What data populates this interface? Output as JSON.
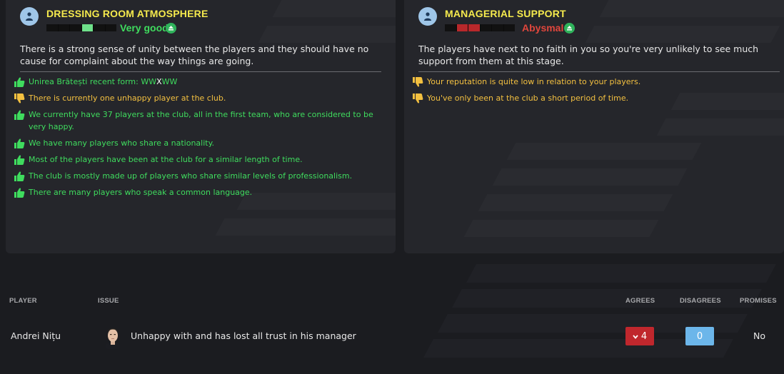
{
  "dressing_room": {
    "title": "DRESSING ROOM ATMOSPHERE",
    "rating": "Very good",
    "rating_color": "#3fdc5e",
    "level": 0.6,
    "summary": "There is a strong sense of unity between the players and they should have no cause for complaint about the way things are going.",
    "reasons": [
      {
        "type": "positive",
        "text": "Unirea Brătești recent form: WWXWW",
        "form": [
          "W",
          "W",
          "X",
          "W",
          "W"
        ]
      },
      {
        "type": "negative",
        "text": "There is currently one unhappy player at the club."
      },
      {
        "type": "positive",
        "text": "We currently have 37 players at the club, all in the first team, who are considered to be very happy."
      },
      {
        "type": "positive",
        "text": "We have many players who share a nationality."
      },
      {
        "type": "positive",
        "text": "Most of the players have been at the club for a similar length of time."
      },
      {
        "type": "positive",
        "text": "The club is mostly made up of players who share similar levels of professionalism."
      },
      {
        "type": "positive",
        "text": "There are many players who speak a common language."
      }
    ]
  },
  "managerial_support": {
    "title": "MANAGERIAL SUPPORT",
    "rating": "Abysmal",
    "rating_color": "#e0463c",
    "level": 0.1,
    "summary": "The players have next to no faith in you so you're very unlikely to see much support from them at this stage.",
    "reasons": [
      {
        "type": "negative",
        "text": "Your reputation is quite low in relation to your players."
      },
      {
        "type": "negative",
        "text": "You've only been at the club a short period of time."
      }
    ]
  },
  "table": {
    "headers": {
      "player": "PLAYER",
      "issue": "ISSUE",
      "agrees": "AGREES",
      "disagrees": "DISAGREES",
      "promises": "PROMISES"
    },
    "rows": [
      {
        "player": "Andrei Nițu",
        "issue": "Unhappy with and has lost all trust in his manager",
        "agrees": "4",
        "disagrees": "0",
        "promises": "No"
      }
    ]
  },
  "colors": {
    "positive": "#3fdc5e",
    "negative": "#f3c040",
    "title": "#f5ea4d",
    "agree": "#c0272d",
    "disagree": "#6cb6ea"
  },
  "icons": {
    "section": "people-icon",
    "positive": "thumbs-up-icon",
    "negative": "thumbs-down-icon",
    "trend": "arrow-up-circle-icon",
    "agree_arrow": "chevron-down-icon"
  }
}
